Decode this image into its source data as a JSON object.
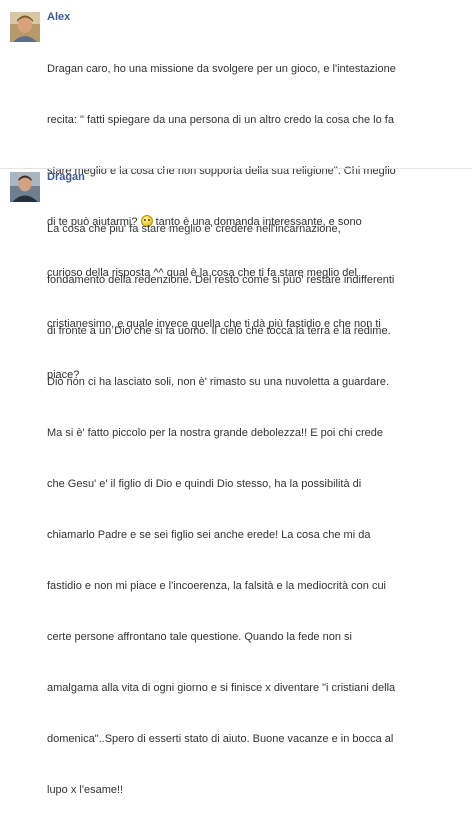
{
  "messages": [
    {
      "author": "Alex",
      "avatar_icon": "user-avatar-icon",
      "lines_before_smiley": [
        "Dragan caro, ho una missione da svolgere per un gioco, e l'intestazione",
        "recita: \" fatti spiegare da una persona di un altro credo la cosa che lo fa",
        "stare meglio e la cosa che non sopporta della sua religione\". Chi meglio"
      ],
      "smiley_line_prefix": "di te può aiutarmi? ",
      "smiley_icon": "smiley-emoticon-icon",
      "smiley_line_suffix": " tanto è una domanda interessante, e sono",
      "lines_after_smiley": [
        "curioso della risposta ^^ qual è la cosa che ti fa stare meglio del",
        "cristianesimo, e quale invece quella che ti dà più fastidio e che non ti",
        "piace?"
      ]
    },
    {
      "author": "Dragan",
      "avatar_icon": "user-avatar-icon",
      "lines": [
        "La cosa che più' fa stare meglio e' credere nell'incarnazione,",
        "fondamento della redenzione. Del resto come si puo' restare indifferenti",
        "di fronte a un Dio che si fa uomo. Il cielo che tocca la terra e la redime.",
        "Dio non ci ha lasciato soli, non è' rimasto su una nuvoletta a guardare.",
        "Ma si è' fatto piccolo per la nostra grande debolezza!! E poi chi crede",
        "che Gesu' e' il figlio di Dio e quindi Dio stesso, ha la possibilità di",
        "chiamarlo Padre e se sei figlio sei anche erede! La cosa che mi da",
        "fastidio e non mi piace e l'incoerenza, la falsità e la mediocrità con cui",
        "certe persone affrontano tale questione. Quando la fede non si",
        "amalgama alla vita di ogni giorno e si finisce x diventare \"i cristiani della",
        "domenica\"..Spero di esserti stato di aiuto. Buone vacanze e in bocca al",
        "lupo x l'esame!!"
      ]
    }
  ]
}
